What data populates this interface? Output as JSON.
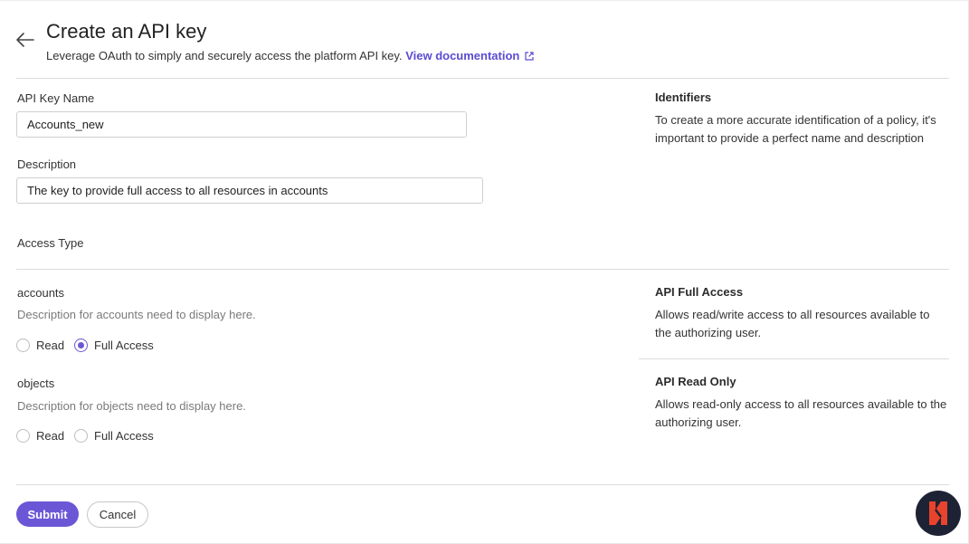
{
  "header": {
    "title": "Create an API key",
    "subtitle": "Leverage OAuth to simply and securely access the platform API key.",
    "doc_link": "View documentation"
  },
  "form": {
    "name_label": "API Key Name",
    "name_value": "Accounts_new",
    "description_label": "Description",
    "description_value": "The key to provide full access to all resources in accounts",
    "access_type_label": "Access Type"
  },
  "identifiers": {
    "title": "Identifiers",
    "text": "To create a more accurate identification of a policy, it's important to provide a perfect name and description"
  },
  "resources": [
    {
      "name": "accounts",
      "description": "Description for accounts need to display here.",
      "options": [
        "Read",
        "Full Access"
      ],
      "selected": "Full Access"
    },
    {
      "name": "objects",
      "description": "Description for objects need to display here.",
      "options": [
        "Read",
        "Full Access"
      ],
      "selected": ""
    }
  ],
  "help": {
    "full_access_title": "API Full Access",
    "full_access_text": "Allows read/write access to all resources available to the authorizing user.",
    "read_only_title": "API Read Only",
    "read_only_text": "Allows read-only access to all resources available to the authorizing user."
  },
  "actions": {
    "submit": "Submit",
    "cancel": "Cancel"
  },
  "colors": {
    "accent": "#6b57d6",
    "link": "#5b4bd1",
    "fab": "#1e2235",
    "fab_logo": "#e8432c"
  }
}
